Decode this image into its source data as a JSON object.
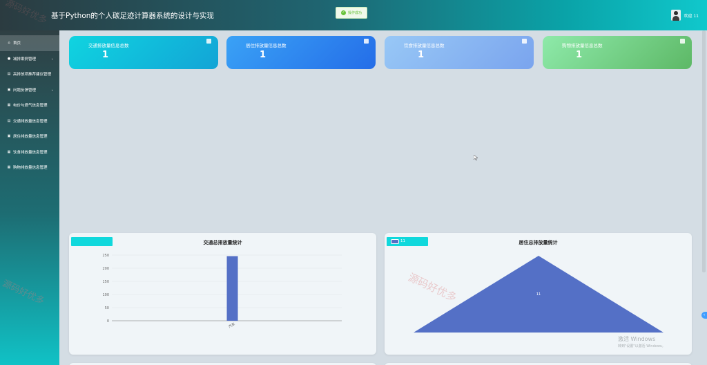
{
  "header": {
    "title": "基于Python的个人碳足迹计算器系统的设计与实现",
    "welcome": "欢迎 11"
  },
  "toast": {
    "text": "操作成功"
  },
  "sidebar": {
    "items": [
      {
        "label": "首页",
        "icon": "home-icon",
        "has_children": false,
        "active": true
      },
      {
        "label": "减排案例管理",
        "icon": "circle-icon",
        "has_children": true
      },
      {
        "label": "高排放项推荐建议管理",
        "icon": "list-icon",
        "has_children": false
      },
      {
        "label": "问题反馈管理",
        "icon": "message-icon",
        "has_children": true
      },
      {
        "label": "电价与燃气信息管理",
        "icon": "grid-icon",
        "has_children": false
      },
      {
        "label": "交通排放量信息管理",
        "icon": "list-icon",
        "has_children": false
      },
      {
        "label": "居住排放量信息管理",
        "icon": "lock-icon",
        "has_children": false
      },
      {
        "label": "饮食排放量信息管理",
        "icon": "grid-icon",
        "has_children": false
      },
      {
        "label": "购物排放量信息管理",
        "icon": "grid-icon",
        "has_children": false
      }
    ]
  },
  "cards": [
    {
      "label": "交通排放量信息总数",
      "value": "1",
      "icon": "layers-icon",
      "gradient": [
        "#10d4e0",
        "#12a4d6"
      ]
    },
    {
      "label": "居住排放量信息总数",
      "value": "1",
      "icon": "document-icon",
      "gradient": [
        "#3aa2f6",
        "#246de8"
      ]
    },
    {
      "label": "饮食排放量信息总数",
      "value": "1",
      "icon": "briefcase-icon",
      "gradient": [
        "#98c8f6",
        "#7aa4ee"
      ]
    },
    {
      "label": "购物排放量信息总数",
      "value": "1",
      "icon": "document-icon",
      "gradient": [
        "#8eeaaa",
        "#5db866"
      ]
    }
  ],
  "chart_data": [
    {
      "type": "bar",
      "title": "交通总排放量统计",
      "categories": [
        "汽车"
      ],
      "values": [
        246
      ],
      "ylim": [
        0,
        250
      ],
      "yticks": [
        0,
        50,
        100,
        150,
        200,
        250
      ],
      "color": "#5470c6",
      "grid": true
    },
    {
      "type": "area",
      "title": "居住总排放量统计",
      "categories": [
        "11"
      ],
      "values": [
        1
      ],
      "legend": [
        "11"
      ],
      "legend_position": "top-left",
      "color": "#5470c6"
    }
  ],
  "watermarks": [
    "源码好优多",
    "源码好优多",
    "源码好优多"
  ],
  "windows": {
    "line1": "激活 Windows",
    "line2": "转到\"设置\"以激活 Windows。"
  }
}
